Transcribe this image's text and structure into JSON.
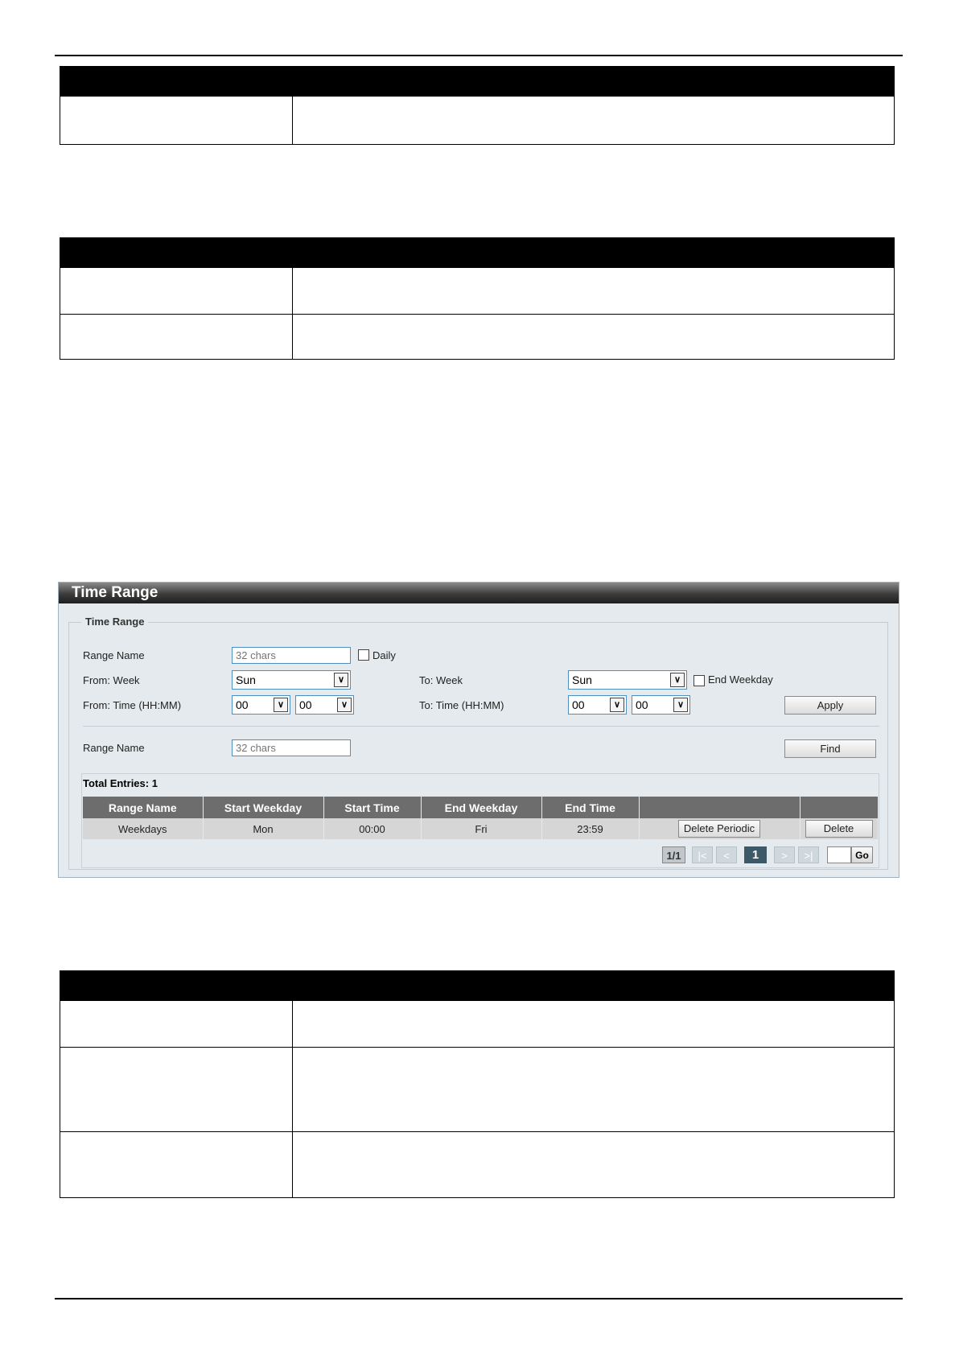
{
  "time_range_panel": {
    "title": "Time Range",
    "legend": "Time Range",
    "range_name_label": "Range Name",
    "range_name_placeholder": "32 chars",
    "daily_label": "Daily",
    "from_week_label": "From: Week",
    "from_week_value": "Sun",
    "to_week_label": "To: Week",
    "to_week_value": "Sun",
    "end_weekday_label": "End Weekday",
    "from_time_label": "From: Time (HH:MM)",
    "from_hour": "00",
    "from_minute": "00",
    "to_time_label": "To: Time (HH:MM)",
    "to_hour": "00",
    "to_minute": "00",
    "apply_label": "Apply",
    "find_range_name_label": "Range Name",
    "find_placeholder": "32 chars",
    "find_label": "Find",
    "total_entries": "Total Entries: 1",
    "columns": [
      "Range Name",
      "Start Weekday",
      "Start Time",
      "End Weekday",
      "End Time",
      "",
      ""
    ],
    "rows": [
      {
        "range_name": "Weekdays",
        "start_weekday": "Mon",
        "start_time": "00:00",
        "end_weekday": "Fri",
        "end_time": "23:59",
        "delete_periodic_label": "Delete Periodic",
        "delete_label": "Delete"
      }
    ],
    "pagination": {
      "info": "1/1",
      "first": "|<",
      "prev": "<",
      "current": "1",
      "next": ">",
      "last": ">|",
      "go_label": "Go"
    }
  }
}
